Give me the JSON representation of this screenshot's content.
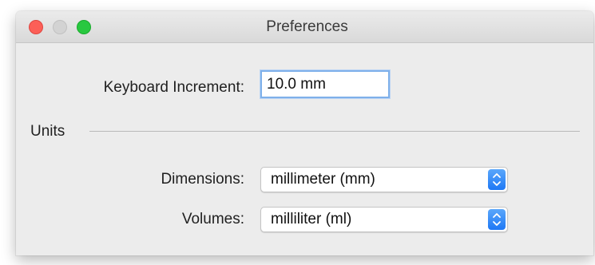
{
  "window": {
    "title": "Preferences",
    "traffic_lights": {
      "close": {
        "icon": "close-icon",
        "color": "#fc5f57"
      },
      "minimize": {
        "icon": "minimize-icon",
        "color": "#d3d3d3"
      },
      "zoom": {
        "icon": "zoom-icon",
        "color": "#29c840"
      }
    }
  },
  "keyboard_increment": {
    "label": "Keyboard Increment:",
    "value": "10.0 mm"
  },
  "units": {
    "section_label": "Units",
    "dimensions": {
      "label": "Dimensions:",
      "selected": "millimeter (mm)"
    },
    "volumes": {
      "label": "Volumes:",
      "selected": "milliliter (ml)"
    }
  },
  "colors": {
    "accent": "#2f86f6",
    "focus_ring": "#7fb0ea",
    "window_background": "#ececec"
  }
}
